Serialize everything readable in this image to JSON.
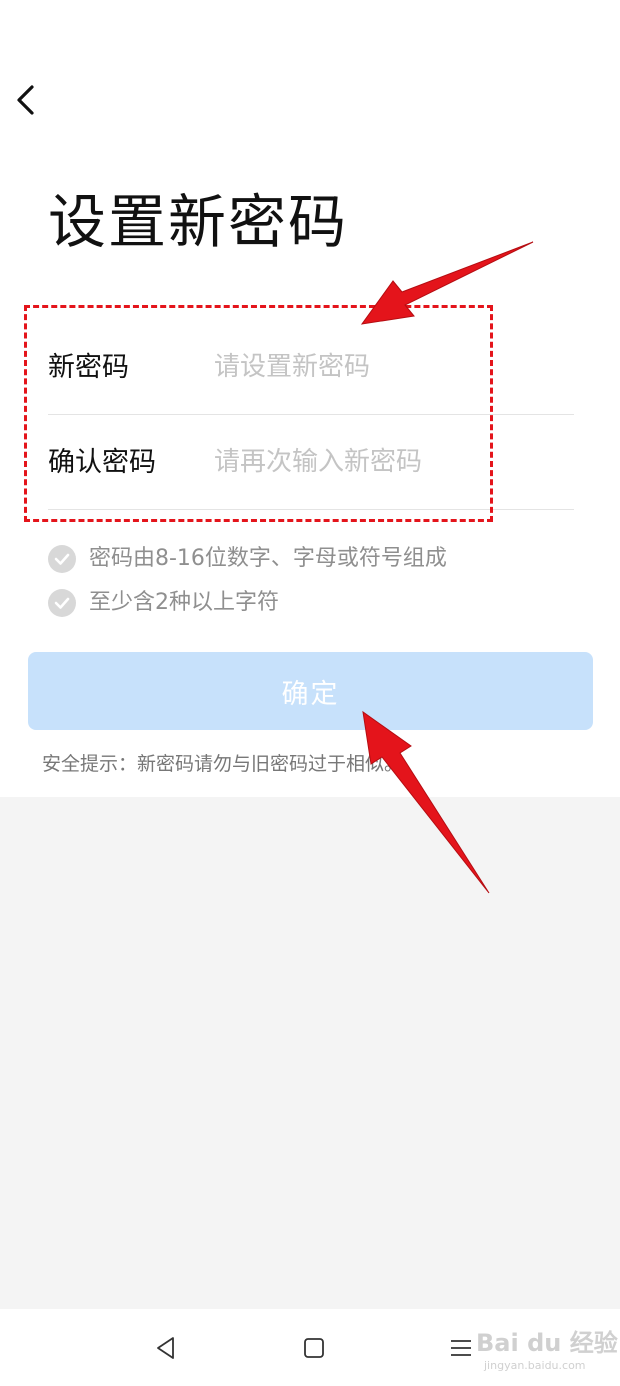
{
  "header": {
    "back_icon": "chevron-left-icon",
    "title": "设置新密码"
  },
  "form": {
    "new_password": {
      "label": "新密码",
      "placeholder": "请设置新密码",
      "value": ""
    },
    "confirm_password": {
      "label": "确认密码",
      "placeholder": "请再次输入新密码",
      "value": ""
    }
  },
  "rules": [
    {
      "icon": "check-circle-icon",
      "text": "密码由8-16位数字、字母或符号组成"
    },
    {
      "icon": "check-circle-icon",
      "text": "至少含2种以上字符"
    }
  ],
  "confirm_button": {
    "label": "确定",
    "color": "#c7e1fb"
  },
  "tip": "安全提示：新密码请勿与旧密码过于相似。",
  "annotation_color": "#e4141b",
  "nav_bar": {
    "back_icon": "triangle-back-icon",
    "home_icon": "square-home-icon",
    "menu_icon": "menu-lines-icon"
  },
  "watermark": {
    "brand": "Bai du 经验",
    "url": "jingyan.baidu.com"
  }
}
